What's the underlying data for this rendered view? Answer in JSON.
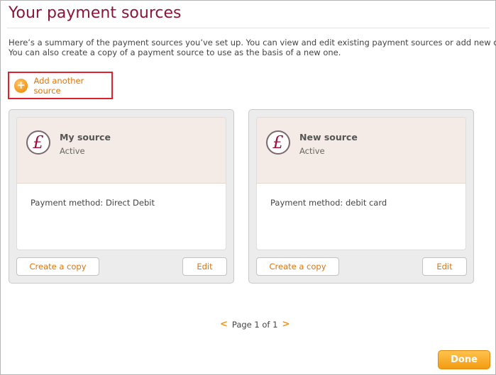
{
  "page": {
    "title": "Your payment sources",
    "intro_line1": "Here’s a summary of the payment sources you’ve set up. You can view and edit existing payment sources or add new ones.",
    "intro_line2": "You can also create a copy of a payment source to use as the basis of a new one."
  },
  "actions": {
    "add_label": "Add another source",
    "done_label": "Done"
  },
  "sources": [
    {
      "icon": "pound-icon",
      "name": "My source",
      "status": "Active",
      "method": "Payment method: Direct Debit",
      "copy_label": "Create a copy",
      "edit_label": "Edit"
    },
    {
      "icon": "pound-icon",
      "name": "New source",
      "status": "Active",
      "method": "Payment method: debit card",
      "copy_label": "Create a copy",
      "edit_label": "Edit"
    }
  ],
  "pager": {
    "prev": "<",
    "text": "Page 1 of 1",
    "next": ">"
  },
  "colors": {
    "title": "#8a1538",
    "accent": "#f39416",
    "highlight_border": "#e0202a"
  }
}
